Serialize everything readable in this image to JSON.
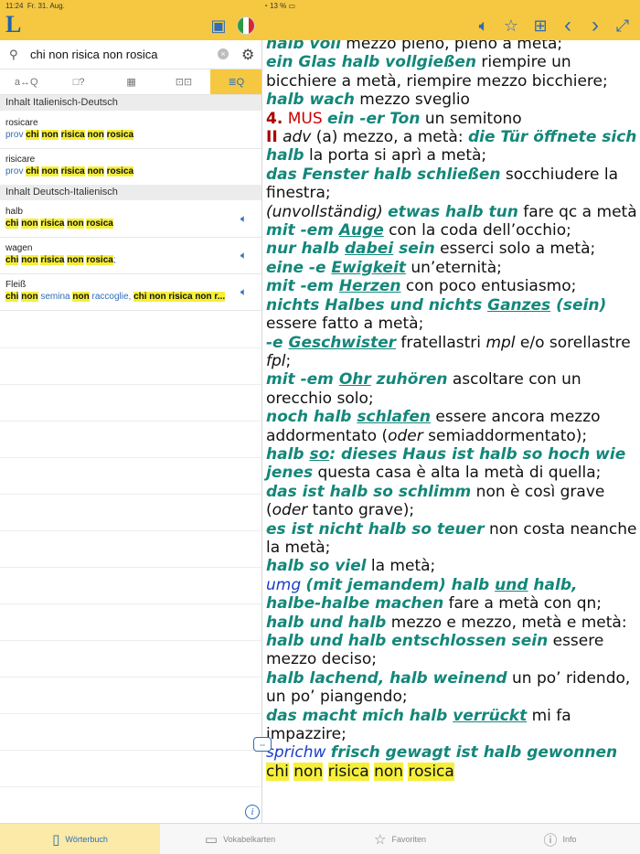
{
  "status": {
    "time": "11:24",
    "date": "Fr. 31. Aug.",
    "right": "13 %"
  },
  "toolbar": {
    "logo": "L",
    "card_icon": "card-icon",
    "speaker_icon": "speaker-icon",
    "favorite_icon": "star-plus-icon",
    "add_icon": "add-card-icon",
    "back_icon": "‹",
    "forward_icon": "›",
    "expand_icon": "⤢"
  },
  "search": {
    "value": "chi non risica non rosica",
    "clear": "×"
  },
  "modes": [
    "a↔Q",
    "□?",
    "▦",
    "⊡⊡",
    "≣Q"
  ],
  "sections": {
    "it_de": "Inhalt Italienisch-Deutsch",
    "de_it": "Inhalt Deutsch-Italienisch"
  },
  "results": [
    {
      "head": "rosicare",
      "prefix": "prov",
      "w1": "chi",
      "w2": "non",
      "w3": "risica",
      "w4": "non",
      "w5": "rosica",
      "extra": ""
    },
    {
      "head": "risicare",
      "prefix": "prov",
      "w1": "chi",
      "w2": "non",
      "w3": "risica",
      "w4": "non",
      "w5": "rosica",
      "extra": ""
    },
    {
      "head": "halb",
      "prefix": "",
      "w1": "chi",
      "w2": "non",
      "w3": "risica",
      "w4": "non",
      "w5": "rosica",
      "extra": ""
    },
    {
      "head": "wagen",
      "prefix": "",
      "w1": "chi",
      "w2": "non",
      "w3": "risica",
      "w4": "non",
      "w5": "rosica",
      "extra": ";"
    },
    {
      "head": "Fleiß",
      "prefix": "",
      "w1": "chi",
      "w2": "non",
      "w3": "semina",
      "w4": "non",
      "w5": "raccoglie,",
      "extra": "chi non risica non r..."
    }
  ],
  "tabs": [
    {
      "label": "Wörterbuch",
      "icon": "book-icon"
    },
    {
      "label": "Vokabelkarten",
      "icon": "cards-icon"
    },
    {
      "label": "Favoriten",
      "icon": "star-icon"
    },
    {
      "label": "Info",
      "icon": "info-icon"
    }
  ]
}
